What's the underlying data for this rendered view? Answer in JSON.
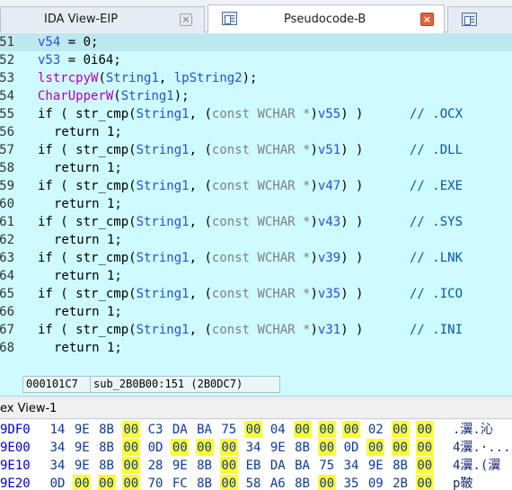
{
  "tabs": [
    {
      "label": "IDA View-EIP",
      "active": false,
      "close_glyph": "×"
    },
    {
      "label": "Pseudocode-B",
      "active": true,
      "close_glyph": "×"
    },
    {
      "label": "",
      "active": false
    }
  ],
  "code": [
    {
      "num": "51",
      "tokens": [
        [
          "var",
          "v54"
        ],
        [
          "kw",
          " = 0;"
        ]
      ]
    },
    {
      "num": "52",
      "tokens": [
        [
          "var",
          "v53"
        ],
        [
          "kw",
          " = 0i64;"
        ]
      ]
    },
    {
      "num": "53",
      "tokens": [
        [
          "fn",
          "lstrcpyW"
        ],
        [
          "kw",
          "("
        ],
        [
          "var",
          "String1"
        ],
        [
          "kw",
          ", "
        ],
        [
          "var",
          "lpString2"
        ],
        [
          "kw",
          ");"
        ]
      ]
    },
    {
      "num": "54",
      "tokens": [
        [
          "fn",
          "CharUpperW"
        ],
        [
          "kw",
          "("
        ],
        [
          "var",
          "String1"
        ],
        [
          "kw",
          ");"
        ]
      ]
    },
    {
      "num": "55",
      "tokens": [
        [
          "kw",
          "if ( str_cmp("
        ],
        [
          "var",
          "String1"
        ],
        [
          "kw",
          ", ("
        ],
        [
          "gray",
          "const WCHAR *"
        ],
        [
          "kw",
          ")"
        ],
        [
          "var",
          "v55"
        ],
        [
          "kw",
          ") )"
        ]
      ],
      "comment": "// .OCX"
    },
    {
      "num": "56",
      "indent": true,
      "tokens": [
        [
          "kw",
          "return 1;"
        ]
      ]
    },
    {
      "num": "57",
      "tokens": [
        [
          "kw",
          "if ( str_cmp("
        ],
        [
          "var",
          "String1"
        ],
        [
          "kw",
          ", ("
        ],
        [
          "gray",
          "const WCHAR *"
        ],
        [
          "kw",
          ")"
        ],
        [
          "var",
          "v51"
        ],
        [
          "kw",
          ") )"
        ]
      ],
      "comment": "// .DLL"
    },
    {
      "num": "58",
      "indent": true,
      "tokens": [
        [
          "kw",
          "return 1;"
        ]
      ]
    },
    {
      "num": "59",
      "tokens": [
        [
          "kw",
          "if ( str_cmp("
        ],
        [
          "var",
          "String1"
        ],
        [
          "kw",
          ", ("
        ],
        [
          "gray",
          "const WCHAR *"
        ],
        [
          "kw",
          ")"
        ],
        [
          "var",
          "v47"
        ],
        [
          "kw",
          ") )"
        ]
      ],
      "comment": "// .EXE"
    },
    {
      "num": "60",
      "indent": true,
      "tokens": [
        [
          "kw",
          "return 1;"
        ]
      ]
    },
    {
      "num": "61",
      "tokens": [
        [
          "kw",
          "if ( str_cmp("
        ],
        [
          "var",
          "String1"
        ],
        [
          "kw",
          ", ("
        ],
        [
          "gray",
          "const WCHAR *"
        ],
        [
          "kw",
          ")"
        ],
        [
          "var",
          "v43"
        ],
        [
          "kw",
          ") )"
        ]
      ],
      "comment": "// .SYS"
    },
    {
      "num": "62",
      "indent": true,
      "tokens": [
        [
          "kw",
          "return 1;"
        ]
      ]
    },
    {
      "num": "63",
      "tokens": [
        [
          "kw",
          "if ( str_cmp("
        ],
        [
          "var",
          "String1"
        ],
        [
          "kw",
          ", ("
        ],
        [
          "gray",
          "const WCHAR *"
        ],
        [
          "kw",
          ")"
        ],
        [
          "var",
          "v39"
        ],
        [
          "kw",
          ") )"
        ]
      ],
      "comment": "// .LNK"
    },
    {
      "num": "64",
      "indent": true,
      "tokens": [
        [
          "kw",
          "return 1;"
        ]
      ]
    },
    {
      "num": "65",
      "tokens": [
        [
          "kw",
          "if ( str_cmp("
        ],
        [
          "var",
          "String1"
        ],
        [
          "kw",
          ", ("
        ],
        [
          "gray",
          "const WCHAR *"
        ],
        [
          "kw",
          ")"
        ],
        [
          "var",
          "v35"
        ],
        [
          "kw",
          ") )"
        ]
      ],
      "comment": "// .ICO"
    },
    {
      "num": "66",
      "indent": true,
      "tokens": [
        [
          "kw",
          "return 1;"
        ]
      ]
    },
    {
      "num": "67",
      "tokens": [
        [
          "kw",
          "if ( str_cmp("
        ],
        [
          "var",
          "String1"
        ],
        [
          "kw",
          ", ("
        ],
        [
          "gray",
          "const WCHAR *"
        ],
        [
          "kw",
          ")"
        ],
        [
          "var",
          "v31"
        ],
        [
          "kw",
          ") )"
        ]
      ],
      "comment": "// .INI"
    },
    {
      "num": "68",
      "indent": true,
      "tokens": [
        [
          "kw",
          "return 1;"
        ]
      ]
    },
    {
      "num": "",
      "tokens": []
    }
  ],
  "status": {
    "address": "000101C7",
    "location": "sub_2B0B00:151 (2B0DC7)"
  },
  "hex_view": {
    "title": "ex View-1",
    "rows": [
      {
        "addr": "9DF0",
        "bytes": [
          "14",
          "9E",
          "8B",
          "00",
          "C3",
          "DA",
          "BA",
          "75",
          "00",
          "04",
          "00",
          "00",
          "00",
          "02",
          "00",
          "00"
        ],
        "ascii": ".瀷.沁"
      },
      {
        "addr": "9E00",
        "bytes": [
          "34",
          "9E",
          "8B",
          "00",
          "0D",
          "00",
          "00",
          "00",
          "34",
          "9E",
          "8B",
          "00",
          "0D",
          "00",
          "00",
          "00"
        ],
        "ascii": "4瀷.·..."
      },
      {
        "addr": "9E10",
        "bytes": [
          "34",
          "9E",
          "8B",
          "00",
          "28",
          "9E",
          "8B",
          "00",
          "EB",
          "DA",
          "BA",
          "75",
          "34",
          "9E",
          "8B",
          "00"
        ],
        "ascii": "4瀷.(瀷"
      },
      {
        "addr": "9E20",
        "bytes": [
          "0D",
          "00",
          "00",
          "00",
          "70",
          "FC",
          "8B",
          "00",
          "58",
          "A6",
          "8B",
          "00",
          "35",
          "09",
          "2B",
          "00"
        ],
        "ascii": "p鞁"
      }
    ]
  }
}
